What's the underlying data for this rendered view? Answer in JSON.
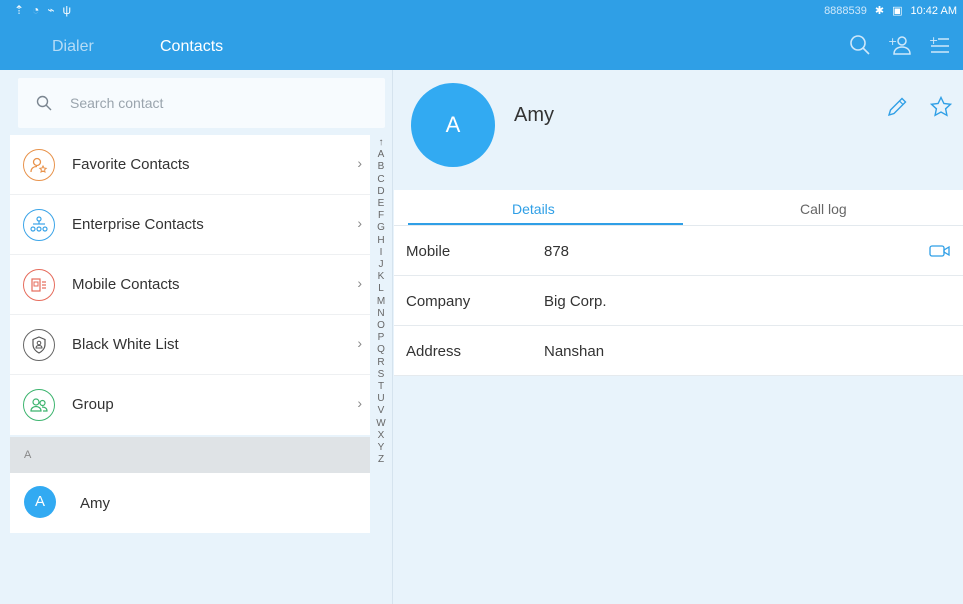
{
  "status_bar": {
    "device_id": "8888539",
    "time": "10:42 AM"
  },
  "top_tabs": {
    "dialer": "Dialer",
    "contacts": "Contacts"
  },
  "search": {
    "placeholder": "Search contact"
  },
  "categories": [
    {
      "label": "Favorite Contacts",
      "icon": "favorite-contacts-icon",
      "color": "#e8924a"
    },
    {
      "label": "Enterprise Contacts",
      "icon": "enterprise-contacts-icon",
      "color": "#3aa4e8"
    },
    {
      "label": "Mobile Contacts",
      "icon": "mobile-contacts-icon",
      "color": "#e66b5b"
    },
    {
      "label": "Black White List",
      "icon": "black-white-list-icon",
      "color": "#666666"
    },
    {
      "label": "Group",
      "icon": "group-icon",
      "color": "#3cb46e"
    }
  ],
  "alpha_index": [
    "↑",
    "A",
    "B",
    "C",
    "D",
    "E",
    "F",
    "G",
    "H",
    "I",
    "J",
    "K",
    "L",
    "M",
    "N",
    "O",
    "P",
    "Q",
    "R",
    "S",
    "T",
    "U",
    "V",
    "W",
    "X",
    "Y",
    "Z"
  ],
  "contact_list": {
    "section": "A",
    "contacts": [
      {
        "initial": "A",
        "name": "Amy"
      }
    ]
  },
  "detail": {
    "initial": "A",
    "name": "Amy",
    "tabs": {
      "details": "Details",
      "call_log": "Call log"
    },
    "rows": [
      {
        "key": "Mobile",
        "value": "878"
      },
      {
        "key": "Company",
        "value": "Big Corp."
      },
      {
        "key": "Address",
        "value": "Nanshan"
      }
    ]
  },
  "colors": {
    "primary": "#2f9fe6",
    "avatar": "#32aaf2"
  }
}
